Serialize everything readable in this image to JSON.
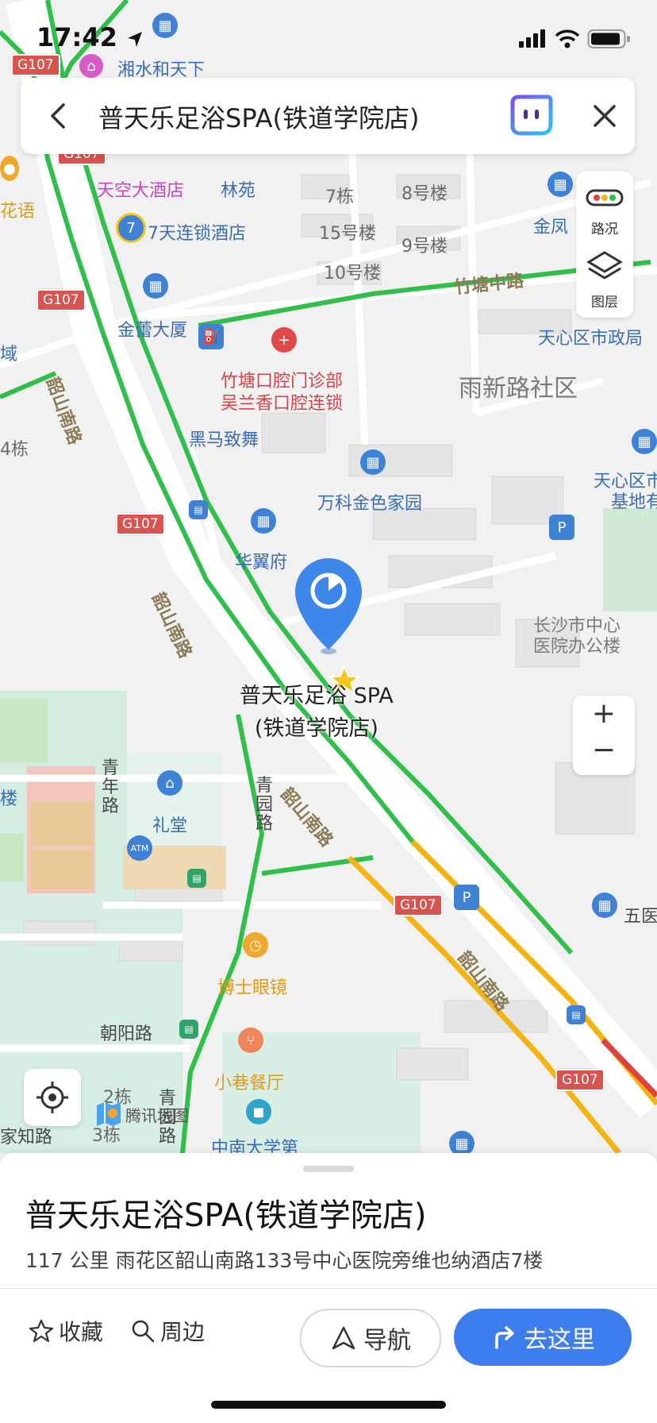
{
  "status_bar": {
    "time": "17:42"
  },
  "search_bar": {
    "query": "普天乐足浴SPA(铁道学院店)"
  },
  "map_controls": {
    "traffic_label": "路况",
    "layers_label": "图层",
    "zoom_in": "+",
    "zoom_out": "−"
  },
  "map": {
    "selected_poi": {
      "line1": "普天乐足浴 SPA",
      "line2": "(铁道学院店)"
    },
    "labels": {
      "xiangshui": "湘水和天下",
      "tiankong": "天空大酒店",
      "linyuan": "林苑",
      "qi_dong": "7栋",
      "ba_hao": "8号楼",
      "qitian": "7天连锁酒店",
      "shiwu_hao": "15号楼",
      "jiu_hao": "9号楼",
      "shi_hao": "10号楼",
      "jinfeng": "金凤",
      "zhutang_rd": "竹塘中路",
      "jinlei": "金蕾大厦",
      "tianxin_gov": "天心区市政局",
      "zhutang_dental1": "竹塘口腔门诊部",
      "zhutang_dental2": "吴兰香口腔连锁",
      "yuxin": "雨新路社区",
      "heima": "黑马致舞",
      "si_dong": "4栋",
      "tianxin_base1": "天心区市",
      "tianxin_base2": "基地有",
      "wanke": "万科金色家园",
      "huayi": "华翼府",
      "shaoshan_rd": "韶山南路",
      "hospital1": "长沙市中心",
      "hospital2": "医院办公楼",
      "qingnian_rd": "青年路",
      "litang": "礼堂",
      "qingyuan_rd": "青园路",
      "wuyi": "五医",
      "boshi": "博士眼镜",
      "chaoyang_rd": "朝阳路",
      "xiaoxiang": "小巷餐厅",
      "er_dong": "2栋",
      "san_dong": "3栋",
      "zhongnan": "中南大学第",
      "qingyuan_rd2": "青园路",
      "huayu": "花语",
      "yu": "域",
      "lou": "楼",
      "zhilu": "家知路",
      "bus_lou": "楼"
    },
    "road_shield": "G107",
    "logo_text": "腾讯地图"
  },
  "place": {
    "name": "普天乐足浴SPA(铁道学院店)",
    "info": "117 公里    雨花区韶山南路133号中心医院旁维也纳酒店7楼"
  },
  "actions": {
    "favorite": "收藏",
    "nearby": "周边",
    "navigate": "导航",
    "go_here": "去这里"
  }
}
